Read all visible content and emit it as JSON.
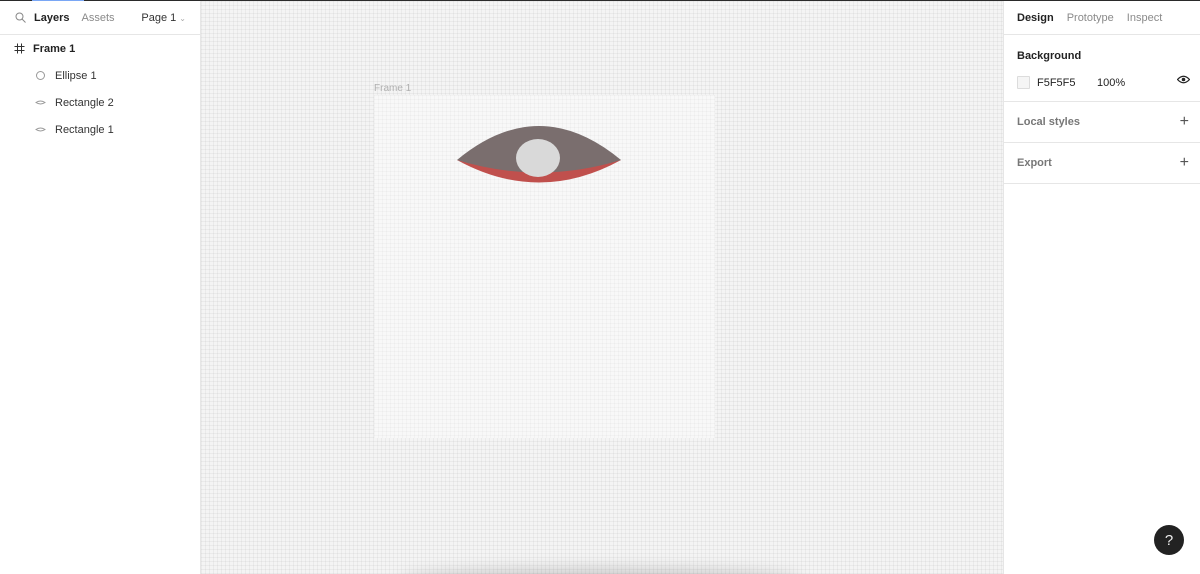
{
  "left_panel": {
    "tabs": [
      "Layers",
      "Assets"
    ],
    "page_select": "Page 1",
    "layers": [
      {
        "name": "Frame 1",
        "type": "frame"
      },
      {
        "name": "Ellipse 1",
        "type": "ellipse"
      },
      {
        "name": "Rectangle 2",
        "type": "rectangle"
      },
      {
        "name": "Rectangle 1",
        "type": "rectangle"
      }
    ],
    "icons": {
      "search": "search-icon",
      "frame": "hash-icon",
      "ellipse": "ellipse-icon",
      "rectangle": "lens-shape-icon",
      "chevron": "chevron-down-icon"
    }
  },
  "canvas": {
    "frame_label": "Frame 1",
    "background_color": "#f4f4f4",
    "eye": {
      "upper_color": "#7a6e6e",
      "lower_color": "#c0504d",
      "pupil_color": "#d9d9d9"
    }
  },
  "right_panel": {
    "tabs": [
      "Design",
      "Prototype",
      "Inspect"
    ],
    "background": {
      "title": "Background",
      "hex": "F5F5F5",
      "opacity": "100%",
      "swatch_color": "#F5F5F5"
    },
    "local_styles": "Local styles",
    "export": "Export"
  },
  "help": "?"
}
